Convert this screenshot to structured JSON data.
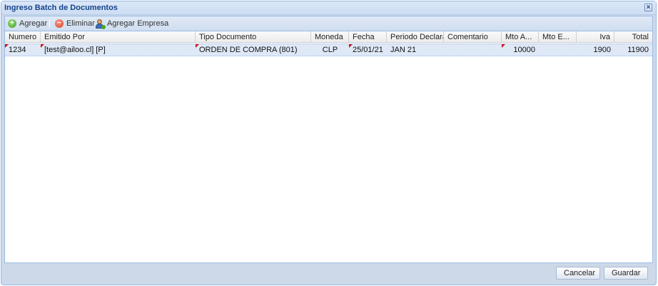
{
  "window": {
    "title": "Ingreso Batch de Documentos",
    "close_glyph": "×"
  },
  "toolbar": {
    "add_label": "Agregar",
    "delete_label": "Eliminar",
    "add_company_label": "Agregar Empresa"
  },
  "grid": {
    "columns": [
      "Numero",
      "Emitido Por",
      "Tipo Documento",
      "Moneda",
      "Fecha",
      "Periodo Declarar",
      "Comentario",
      "Mto A...",
      "Mto E...",
      "Iva",
      "Total"
    ],
    "rows": [
      {
        "numero": "1234",
        "emitido_por": "[test@ailoo.cl] [P]",
        "tipo_documento": "ORDEN DE COMPRA (801)",
        "moneda": "CLP",
        "fecha": "25/01/21",
        "periodo_declarar": "JAN 21",
        "comentario": "",
        "mto_a": "10000",
        "mto_e": "",
        "iva": "1900",
        "total": "11900"
      }
    ]
  },
  "footer": {
    "cancel_label": "Cancelar",
    "save_label": "Guardar"
  },
  "colors": {
    "title_text": "#15428b",
    "selected_row": "#dfe8f6",
    "dirty_marker": "#d01010",
    "border": "#99bbe8"
  }
}
